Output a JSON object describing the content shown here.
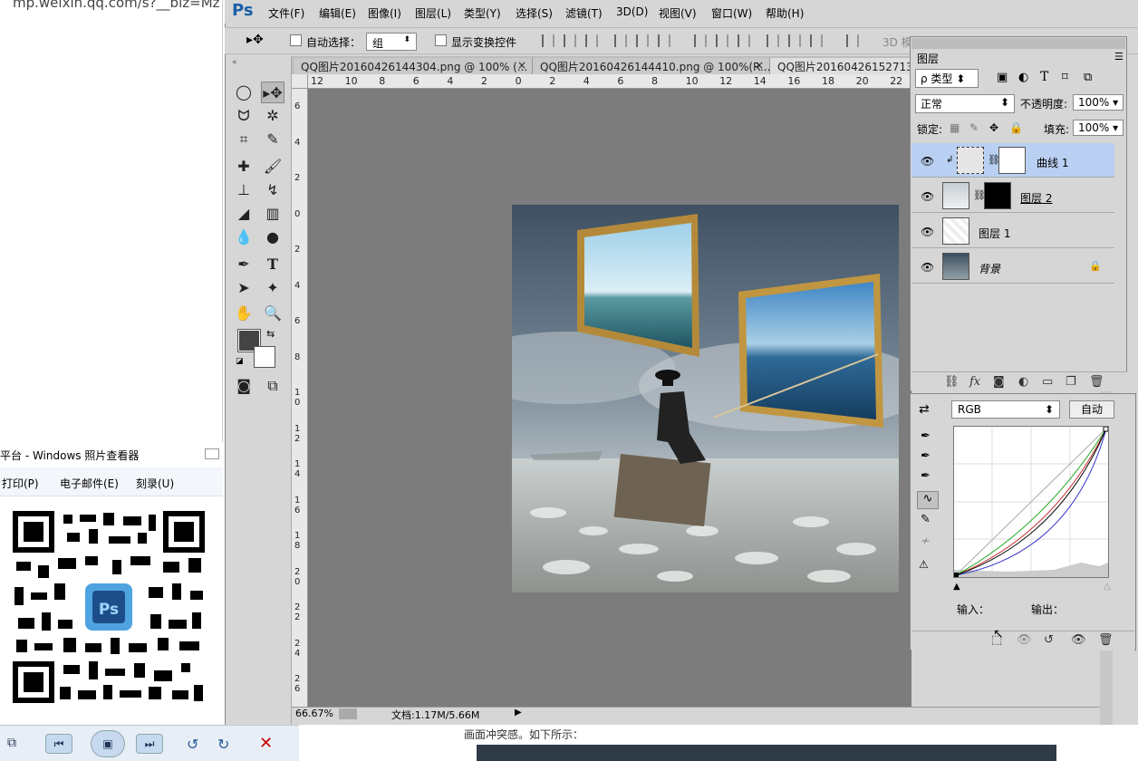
{
  "browser": {
    "url_fragment": "mp.weixin.qq.com/s?__biz=Mz"
  },
  "photo_viewer": {
    "title": "平台 - Windows 照片查看器",
    "menu": [
      "打印(P)",
      "电子邮件(E)",
      "刻录(U)"
    ],
    "qr_center_label": "Ps"
  },
  "webpage": {
    "caption": "画面冲突感。如下所示："
  },
  "ps": {
    "logo": "Ps",
    "menu": [
      "文件(F)",
      "编辑(E)",
      "图像(I)",
      "图层(L)",
      "类型(Y)",
      "选择(S)",
      "滤镜(T)",
      "3D(D)",
      "视图(V)",
      "窗口(W)",
      "帮助(H)"
    ],
    "options": {
      "auto_select_label": "自动选择：",
      "auto_select_value": "组",
      "show_transform_label": "显示变换控件",
      "mode_3d": "3D 模"
    },
    "tabs": [
      "QQ图片20160426144304.png @ 100% (...",
      "QQ图片20160426144410.png @ 100%(R...",
      "QQ图片20160426152713.p"
    ],
    "ruler_top": [
      "12",
      "10",
      "8",
      "6",
      "4",
      "2",
      "0",
      "2",
      "4",
      "6",
      "8",
      "10",
      "12",
      "14",
      "16",
      "18",
      "20",
      "22"
    ],
    "ruler_left": [
      "6",
      "4",
      "2",
      "0",
      "2",
      "4",
      "6",
      "8",
      "1 0",
      "1 2",
      "1 4",
      "1 6",
      "1 8",
      "2 0",
      "2 2",
      "2 4",
      "2 6"
    ],
    "status": {
      "zoom": "66.67%",
      "doc": "文档:1.17M/5.66M"
    },
    "layers": {
      "title": "图层",
      "filter": "ρ 类型",
      "blend": "正常",
      "opacity_label": "不透明度:",
      "opacity": "100%",
      "lock_label": "锁定:",
      "fill_label": "填充:",
      "fill": "100%",
      "items": [
        {
          "name": "曲线 1",
          "selected": true
        },
        {
          "name": "图层 2",
          "selected": false
        },
        {
          "name": "图层 1",
          "selected": false
        },
        {
          "name": "背景",
          "selected": false
        }
      ]
    },
    "properties": {
      "channel": "RGB",
      "auto": "自动",
      "input": "输入：",
      "output": "输出："
    }
  }
}
